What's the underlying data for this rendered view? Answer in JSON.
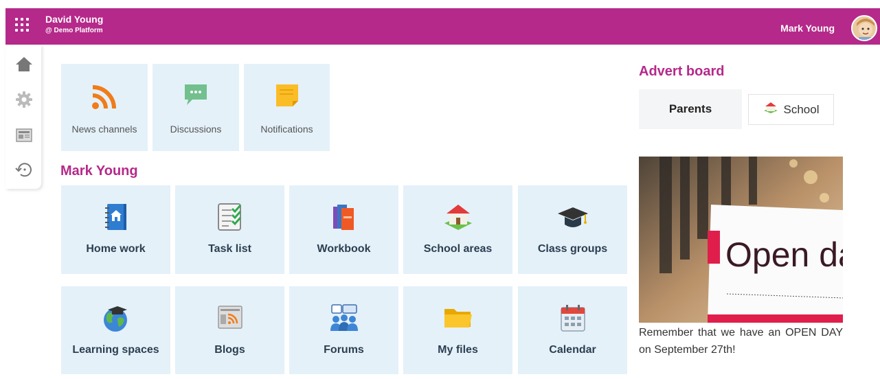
{
  "header": {
    "user_name": "David Young",
    "platform": "@ Demo Platform",
    "current_user": "Mark Young",
    "brand_color": "#b5298a"
  },
  "sidebar": {
    "items": [
      {
        "icon": "home-icon"
      },
      {
        "icon": "gear-icon"
      },
      {
        "icon": "newspaper-icon"
      },
      {
        "icon": "history-icon"
      }
    ]
  },
  "quick_tiles": [
    {
      "label": "News channels",
      "icon": "rss-icon"
    },
    {
      "label": "Discussions",
      "icon": "chat-icon"
    },
    {
      "label": "Notifications",
      "icon": "sticky-note-icon"
    }
  ],
  "section": {
    "title": "Mark Young"
  },
  "main_tiles": [
    {
      "label": "Home work",
      "icon": "homework-book-icon"
    },
    {
      "label": "Task list",
      "icon": "checklist-icon"
    },
    {
      "label": "Workbook",
      "icon": "books-icon"
    },
    {
      "label": "School areas",
      "icon": "school-house-icon"
    },
    {
      "label": "Class groups",
      "icon": "graduation-cap-icon"
    },
    {
      "label": "Learning spaces",
      "icon": "globe-icon"
    },
    {
      "label": "Blogs",
      "icon": "blog-icon"
    },
    {
      "label": "Forums",
      "icon": "forum-people-icon"
    },
    {
      "label": "My files",
      "icon": "folder-icon"
    },
    {
      "label": "Calendar",
      "icon": "calendar-icon"
    }
  ],
  "advert": {
    "title": "Advert board",
    "tab_parents": "Parents",
    "tab_school": "School",
    "image_text": "Open day",
    "message": "Remember that we have an OPEN DAY on September 27th!"
  }
}
